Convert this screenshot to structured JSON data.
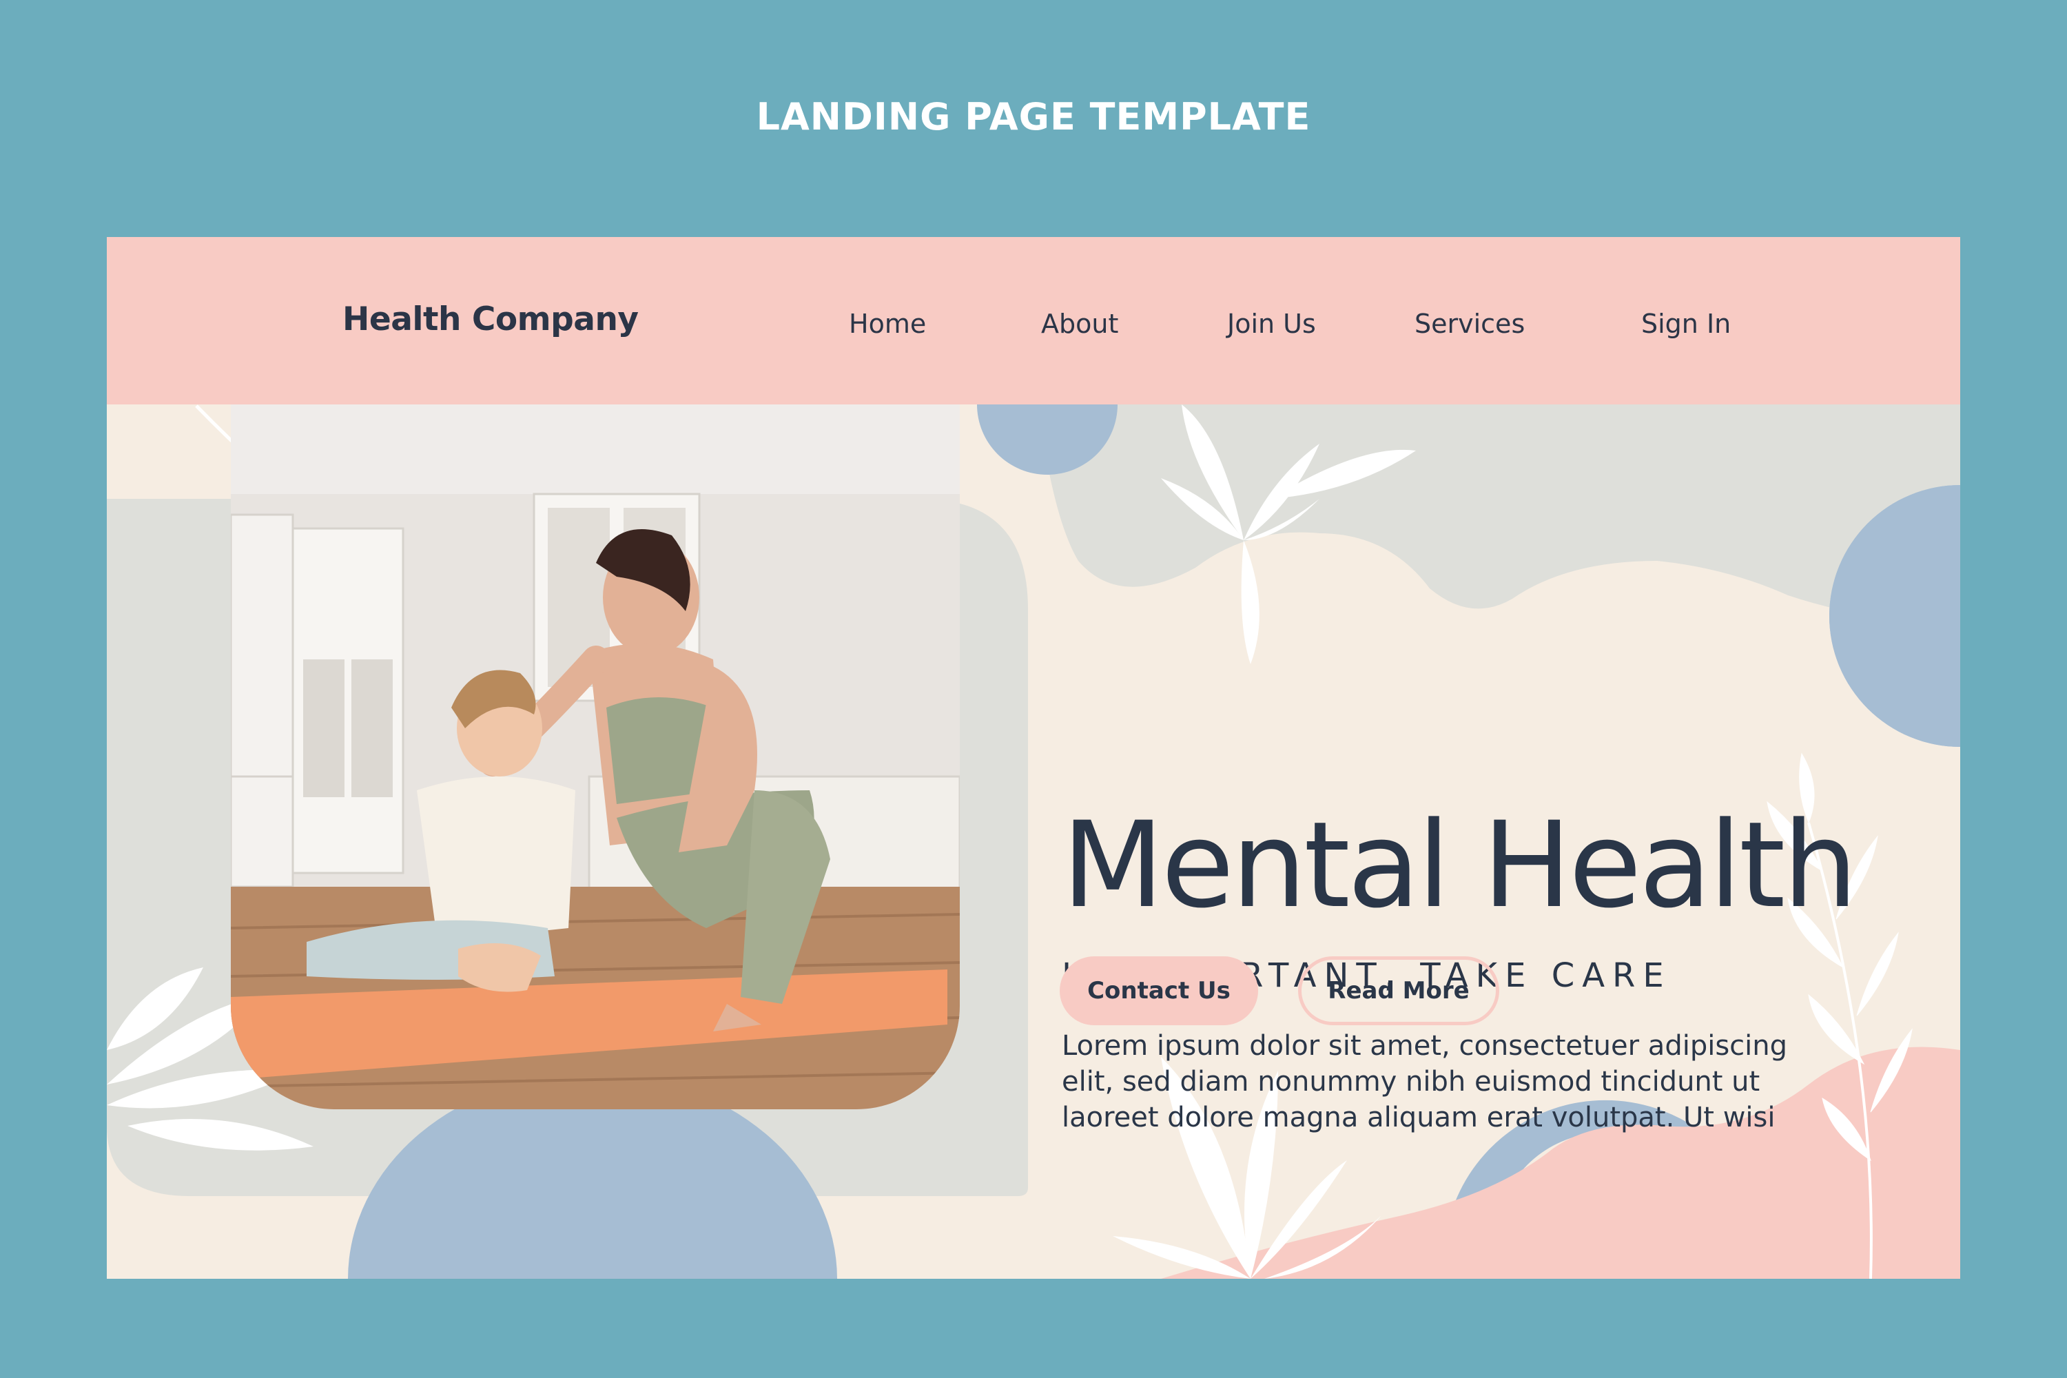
{
  "banner": {
    "title": "LANDING PAGE TEMPLATE"
  },
  "header": {
    "brand": "Health Company",
    "nav": [
      "Home",
      "About",
      "Join Us",
      "Services",
      "Sign In"
    ]
  },
  "hero": {
    "headline": "Mental Health",
    "subhead": "IS IMPORTANT, TAKE CARE",
    "body_lines": [
      "Lorem ipsum dolor sit amet, consectetuer adipiscing",
      "elit, sed diam nonummy nibh euismod tincidunt ut",
      "laoreet dolore magna aliquam erat volutpat. Ut wisi"
    ],
    "buttons": {
      "contact": "Contact Us",
      "read_more": "Read More"
    }
  },
  "colors": {
    "background": "#6cadbd",
    "header": "#f8cbc4",
    "page": "#f6ede2",
    "text": "#2a3648",
    "blue_shape": "#a6bdd3",
    "grey_shape": "#dedfda",
    "pink_shape": "#f8cbc4"
  }
}
